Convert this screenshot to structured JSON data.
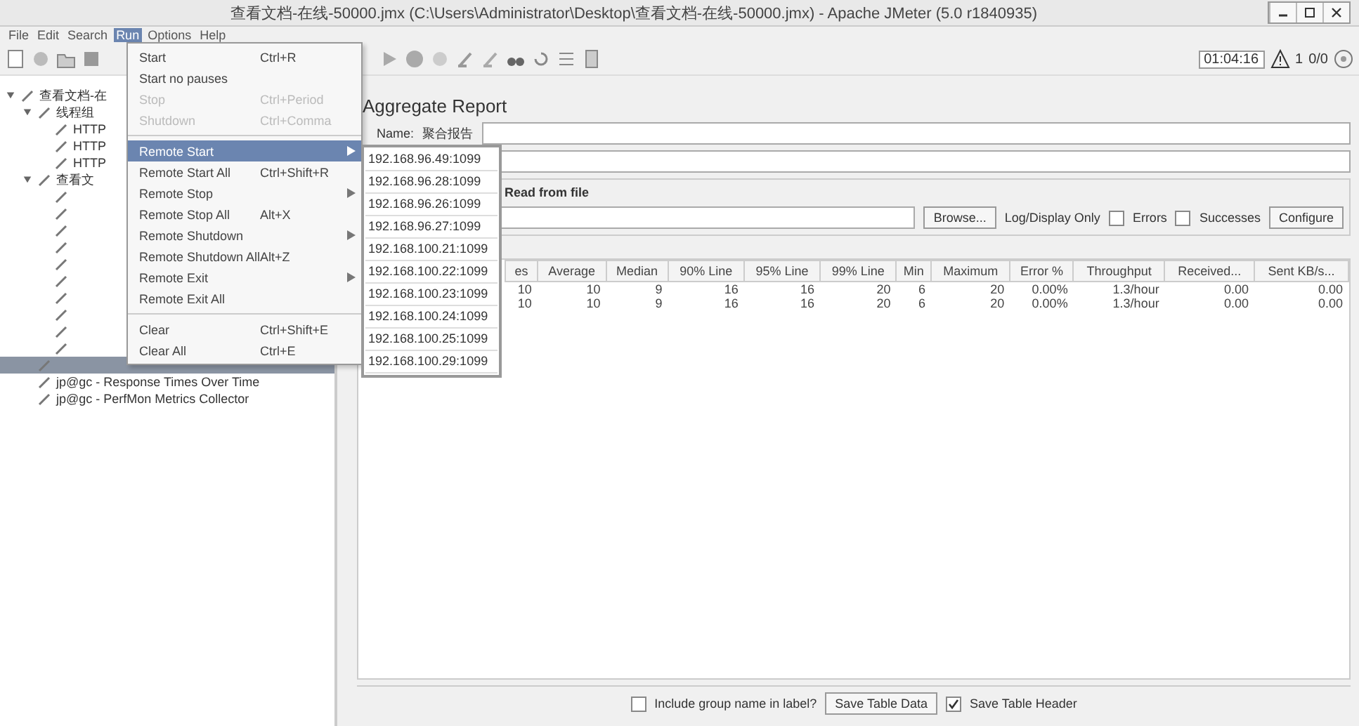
{
  "window": {
    "title": "查看文档-在线-50000.jmx (C:\\Users\\Administrator\\Desktop\\查看文档-在线-50000.jmx) - Apache JMeter (5.0 r1840935)"
  },
  "menubar": [
    {
      "label": "File",
      "selected": false
    },
    {
      "label": "Edit",
      "selected": false
    },
    {
      "label": "Search",
      "selected": false
    },
    {
      "label": "Run",
      "selected": true
    },
    {
      "label": "Options",
      "selected": false
    },
    {
      "label": "Help",
      "selected": false
    }
  ],
  "run_menu": [
    {
      "kind": "item",
      "label": "Start",
      "shortcut": "Ctrl+R",
      "disabled": false,
      "selected": false,
      "submenu": false
    },
    {
      "kind": "item",
      "label": "Start no pauses",
      "disabled": false,
      "selected": false,
      "submenu": false
    },
    {
      "kind": "item",
      "label": "Stop",
      "shortcut": "Ctrl+Period",
      "disabled": true,
      "selected": false,
      "submenu": false
    },
    {
      "kind": "item",
      "label": "Shutdown",
      "shortcut": "Ctrl+Comma",
      "disabled": true,
      "selected": false,
      "submenu": false
    },
    {
      "kind": "separator"
    },
    {
      "kind": "item",
      "label": "Remote Start",
      "disabled": false,
      "selected": true,
      "submenu": true
    },
    {
      "kind": "item",
      "label": "Remote Start All",
      "shortcut": "Ctrl+Shift+R",
      "disabled": false,
      "selected": false,
      "submenu": false
    },
    {
      "kind": "item",
      "label": "Remote Stop",
      "disabled": false,
      "selected": false,
      "submenu": true
    },
    {
      "kind": "item",
      "label": "Remote Stop All",
      "shortcut": "Alt+X",
      "disabled": false,
      "selected": false,
      "submenu": false
    },
    {
      "kind": "item",
      "label": "Remote Shutdown",
      "disabled": false,
      "selected": false,
      "submenu": true
    },
    {
      "kind": "item",
      "label": "Remote Shutdown All",
      "shortcut": "Alt+Z",
      "disabled": false,
      "selected": false,
      "submenu": false
    },
    {
      "kind": "item",
      "label": "Remote Exit",
      "disabled": false,
      "selected": false,
      "submenu": true
    },
    {
      "kind": "item",
      "label": "Remote Exit All",
      "disabled": false,
      "selected": false,
      "submenu": false
    },
    {
      "kind": "separator"
    },
    {
      "kind": "item",
      "label": "Clear",
      "shortcut": "Ctrl+Shift+E",
      "disabled": false,
      "selected": false,
      "submenu": false
    },
    {
      "kind": "item",
      "label": "Clear All",
      "shortcut": "Ctrl+E",
      "disabled": false,
      "selected": false,
      "submenu": false
    }
  ],
  "remote_hosts": [
    "192.168.96.49:1099",
    "192.168.96.28:1099",
    "192.168.96.26:1099",
    "192.168.96.27:1099",
    "192.168.100.21:1099",
    "192.168.100.22:1099",
    "192.168.100.23:1099",
    "192.168.100.24:1099",
    "192.168.100.25:1099",
    "192.168.100.29:1099"
  ],
  "tree": [
    {
      "label": "查看文档-在",
      "expanded": true,
      "selected": false,
      "children": [
        {
          "label": "线程组",
          "expanded": true,
          "selected": false,
          "children": [
            {
              "label": "HTTP",
              "selected": false
            },
            {
              "label": "HTTP",
              "selected": false
            },
            {
              "label": "HTTP",
              "selected": false
            }
          ]
        },
        {
          "label": "查看文",
          "expanded": true,
          "selected": false,
          "children": [
            {
              "selected": false
            },
            {
              "selected": false
            },
            {
              "selected": false
            },
            {
              "selected": false
            },
            {
              "selected": false
            },
            {
              "selected": false
            },
            {
              "selected": false
            },
            {
              "selected": false
            },
            {
              "selected": false
            },
            {
              "selected": false
            }
          ]
        },
        {
          "selected": true
        },
        {
          "label": "jp@gc - Response Times Over Time",
          "selected": false
        },
        {
          "label": "jp@gc - PerfMon Metrics Collector",
          "selected": false
        }
      ]
    }
  ],
  "status": {
    "timer": "01:04:16",
    "warnings": "1",
    "threads": "0/0"
  },
  "panel": {
    "title": "Aggregate Report",
    "name_label": "Name:",
    "name_value": "聚合报告",
    "file_legend": "Read from file",
    "browse": "Browse...",
    "log_display": "Log/Display Only",
    "errors": {
      "label": "Errors",
      "checked": false
    },
    "successes": {
      "label": "Successes",
      "checked": false
    },
    "configure": "Configure"
  },
  "table": {
    "columns": [
      "es",
      "Average",
      "Median",
      "90% Line",
      "95% Line",
      "99% Line",
      "Min",
      "Maximum",
      "Error %",
      "Throughput",
      "Received...",
      "Sent KB/s..."
    ],
    "rows": [
      [
        "10",
        "10",
        "9",
        "16",
        "16",
        "20",
        "6",
        "20",
        "0.00%",
        "1.3/hour",
        "0.00",
        "0.00"
      ],
      [
        "10",
        "10",
        "9",
        "16",
        "16",
        "20",
        "6",
        "20",
        "0.00%",
        "1.3/hour",
        "0.00",
        "0.00"
      ]
    ]
  },
  "footer": {
    "include_group": {
      "label": "Include group name in label?",
      "checked": false
    },
    "save_data": "Save Table Data",
    "save_header": {
      "label": "Save Table Header",
      "checked": true
    }
  }
}
